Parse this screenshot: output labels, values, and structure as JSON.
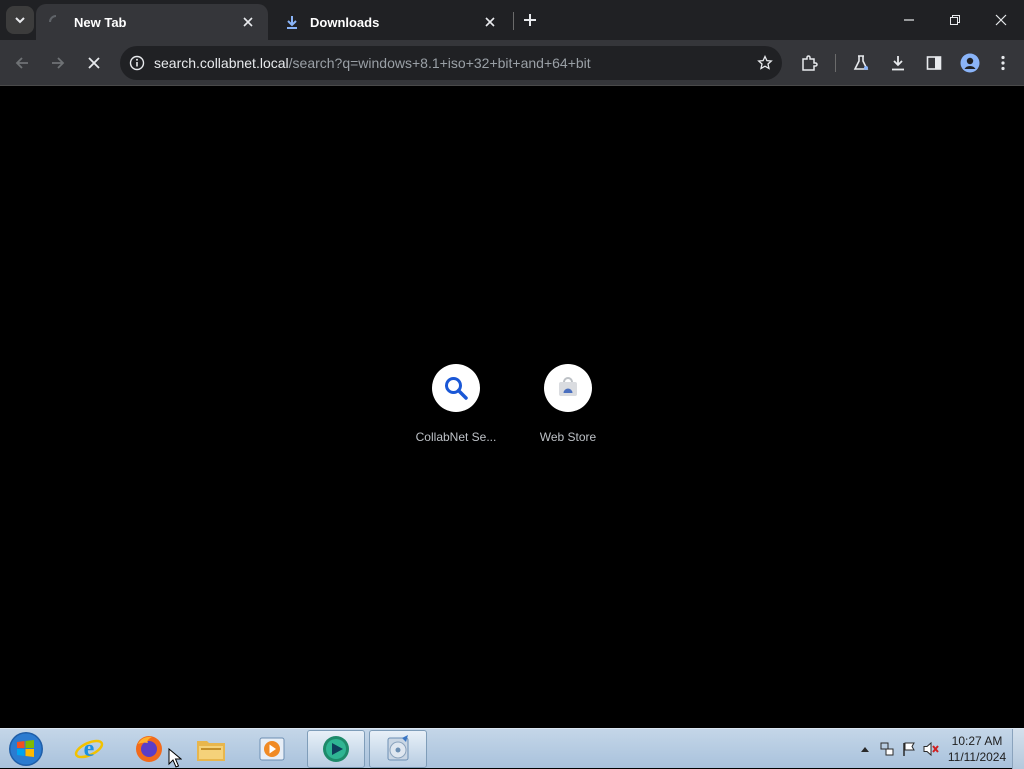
{
  "browser": {
    "tabs": [
      {
        "title": "New Tab",
        "favicon": "loading-spinner-icon",
        "active": true
      },
      {
        "title": "Downloads",
        "favicon": "download-icon",
        "active": false
      }
    ],
    "address": {
      "host": "search.collabnet.local",
      "path": "/search?q=windows+8.1+iso+32+bit+and+64+bit"
    }
  },
  "shortcuts": [
    {
      "label": "CollabNet Se...",
      "icon": "search-icon"
    },
    {
      "label": "Web Store",
      "icon": "web-store-icon"
    }
  ],
  "taskbar": {
    "apps": [
      "internet-explorer-icon",
      "firefox-icon",
      "file-explorer-icon",
      "media-player-icon",
      "chrome-like-icon",
      "cd-burner-icon"
    ],
    "clock": {
      "time": "10:27 AM",
      "date": "11/11/2024"
    }
  },
  "colors": {
    "accent": "#8ab4f8",
    "tab_bg": "#35363a",
    "frame_bg": "#202124"
  }
}
